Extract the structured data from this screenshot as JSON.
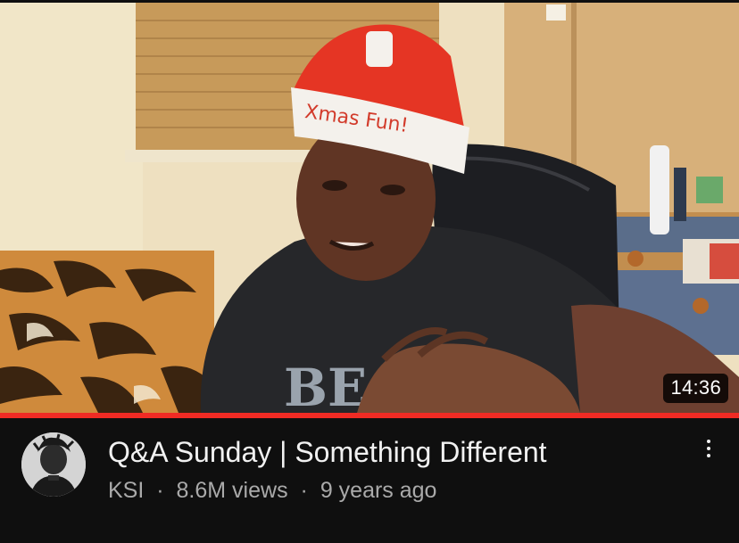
{
  "video": {
    "title": "Q&A Sunday | Something Different",
    "channel": "KSI",
    "separator": "·",
    "views": "8.6M views",
    "age": "9 years ago",
    "duration": "14:36",
    "watch_progress": 1.0,
    "hat_text": "Xmas Fun!",
    "shirt_text": "BEAST"
  },
  "colors": {
    "background": "#0f0f0f",
    "progress": "#f02b24",
    "title": "#f1f1f1",
    "meta": "#aaaaaa"
  },
  "icons": {
    "more": "more-vertical-icon"
  }
}
